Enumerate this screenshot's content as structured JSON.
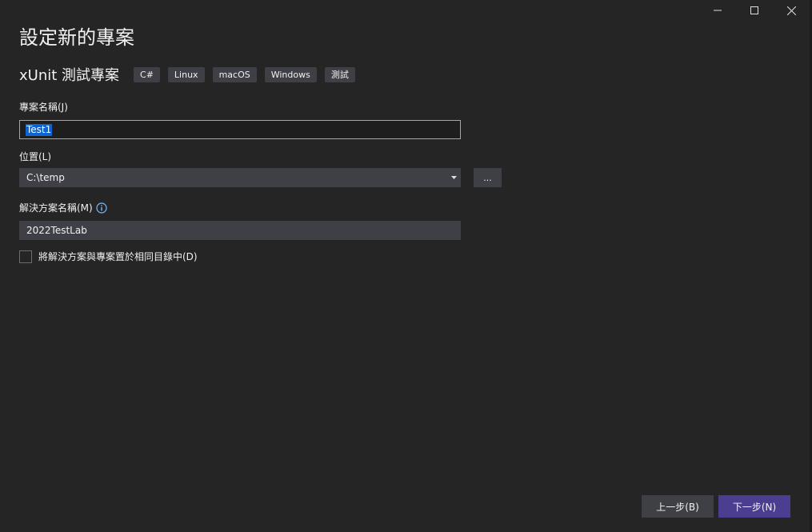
{
  "window": {
    "title": "設定新的專案",
    "controls": {
      "minimize_icon": "minimize-icon",
      "maximize_icon": "maximize-icon",
      "close_icon": "close-icon"
    }
  },
  "template": {
    "name": "xUnit 測試專案",
    "tags": [
      "C#",
      "Linux",
      "macOS",
      "Windows",
      "測試"
    ]
  },
  "project_name": {
    "label": "專案名稱(J)",
    "value": "Test1"
  },
  "location": {
    "label": "位置(L)",
    "value": "C:\\temp",
    "browse_label": "..."
  },
  "solution_name": {
    "label": "解決方案名稱(M)",
    "value": "2022TestLab",
    "info_icon": "info-icon"
  },
  "same_directory": {
    "label": "將解決方案與專案置於相同目錄中(D)",
    "checked": false
  },
  "footer": {
    "back_label": "上一步(B)",
    "next_label": "下一步(N)"
  },
  "colors": {
    "background": "#252526",
    "input_bg": "#3f3f46",
    "selection": "#0e64d1",
    "next_button": "#4b3d8f",
    "info_icon": "#75beff"
  }
}
